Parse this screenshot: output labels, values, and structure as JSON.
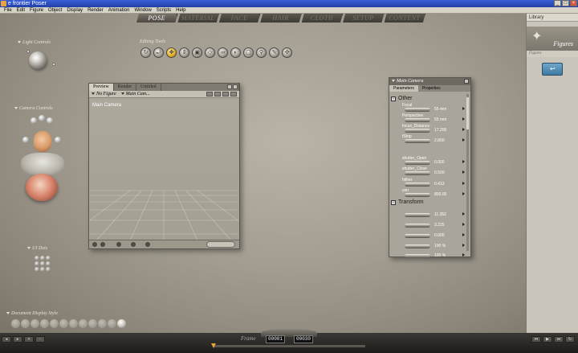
{
  "window": {
    "title": "e frontier Poser"
  },
  "menu": [
    "File",
    "Edit",
    "Figure",
    "Object",
    "Display",
    "Render",
    "Animation",
    "Window",
    "Scripts",
    "Help"
  ],
  "room_tabs": [
    {
      "label": "POSE",
      "active": true
    },
    {
      "label": "MATERIAL",
      "active": false
    },
    {
      "label": "FACE",
      "active": false
    },
    {
      "label": "HAIR",
      "active": false
    },
    {
      "label": "CLOTH",
      "active": false
    },
    {
      "label": "SETUP",
      "active": false
    },
    {
      "label": "CONTENT",
      "active": false
    }
  ],
  "light_controls": {
    "label": "Light Controls"
  },
  "camera_controls": {
    "label": "Camera Controls"
  },
  "ui_dots": {
    "label": "UI Dots"
  },
  "document_display_style": {
    "label": "Document Display Style"
  },
  "editing_tools": {
    "label": "Editing Tools",
    "count": 12,
    "active_index": 2
  },
  "preview": {
    "tabs": [
      "Preview",
      "Render",
      "Untitled"
    ],
    "figure_select": "No Figure",
    "camera_select": "Main Cam...",
    "camera_name": "Main Camera"
  },
  "parameters": {
    "title": "Main Camera",
    "tabs": [
      "Parameters",
      "Properties"
    ],
    "sections": [
      {
        "name": "Other",
        "rows": [
          {
            "label": "Focal",
            "value": "55 mm"
          },
          {
            "label": "Perspective",
            "value": "55 mm"
          },
          {
            "label": "focus_Distance",
            "value": "17.200"
          },
          {
            "label": "fStop",
            "value": "2.800"
          },
          {
            "label": "shutter_Open",
            "value": "0.000"
          },
          {
            "label": "shutter_Close",
            "value": "0.500"
          },
          {
            "label": "hither",
            "value": "0.413"
          },
          {
            "label": "yon",
            "value": "800.00"
          }
        ]
      },
      {
        "name": "Transform",
        "rows": [
          {
            "label": "",
            "value": "11.352"
          },
          {
            "label": "",
            "value": "3.225"
          },
          {
            "label": "",
            "value": "0.000"
          },
          {
            "label": "",
            "value": "100 %"
          },
          {
            "label": "",
            "value": "100 %"
          }
        ]
      }
    ]
  },
  "library": {
    "header": "Library",
    "category": "Figures",
    "subheader": "Figures"
  },
  "timeline": {
    "frame_label": "Frame",
    "current_frame": "00001",
    "total_frames": "00030"
  },
  "colors": {
    "title_bar": "#2a4fc8",
    "active_tool": "#e0a824",
    "folder": "#4a86ae"
  }
}
